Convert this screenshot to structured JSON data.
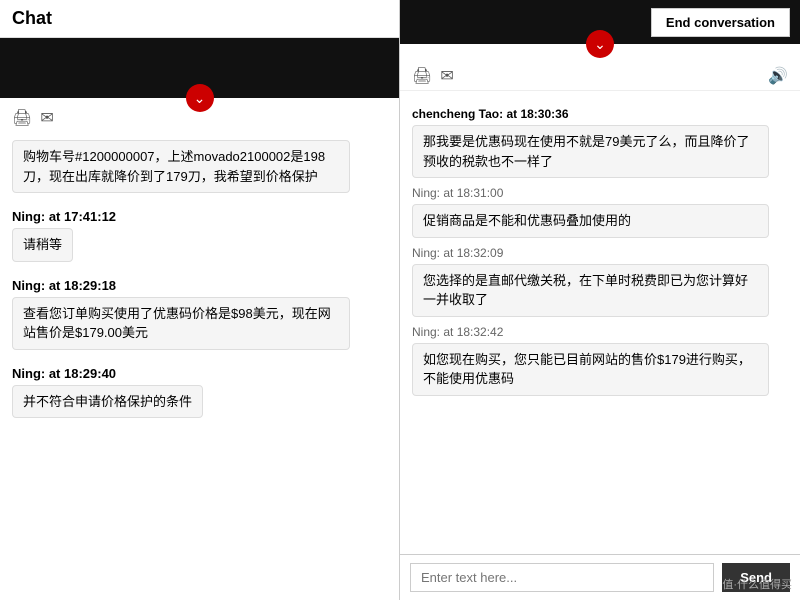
{
  "left": {
    "title": "Chat",
    "message1": "购物车号#1200000007，上述movado2100002是198刀，现在出库就降价到了179刀，我希望到价格保护",
    "sender1": "Ning: at 17:41:12",
    "msg_wait": "请稍等",
    "sender2": "Ning: at 18:29:18",
    "msg2": "查看您订单购买使用了优惠码价格是$98美元，现在网站售价是$179.00美元",
    "sender3": "Ning: at 18:29:40",
    "msg3": "并不符合申请价格保护的条件",
    "print_icon": "🖨",
    "email_icon": "✉"
  },
  "right": {
    "end_btn": "End conversation",
    "header_sender": "chencheng Tao: at 18:30:36",
    "msg_cc1": "那我要是优惠码现在使用不就是79美元了么，而且降价了预收的税款也不一样了",
    "sender_ning1": "Ning: at 18:31:00",
    "msg_ning1": "促销商品是不能和优惠码叠加使用的",
    "sender_ning2": "Ning: at 18:32:09",
    "msg_ning2": "您选择的是直邮代缴关税，在下单时税费即已为您计算好一并收取了",
    "sender_ning3": "Ning: at 18:32:42",
    "msg_ning3": "如您现在购买，您只能已目前网站的售价$179进行购买，不能使用优惠码",
    "input_placeholder": "Enter text here...",
    "send_label": "Send",
    "print_icon": "🖨",
    "email_icon": "✉",
    "volume_icon": "🔊"
  },
  "watermark": "值·什么值得买"
}
